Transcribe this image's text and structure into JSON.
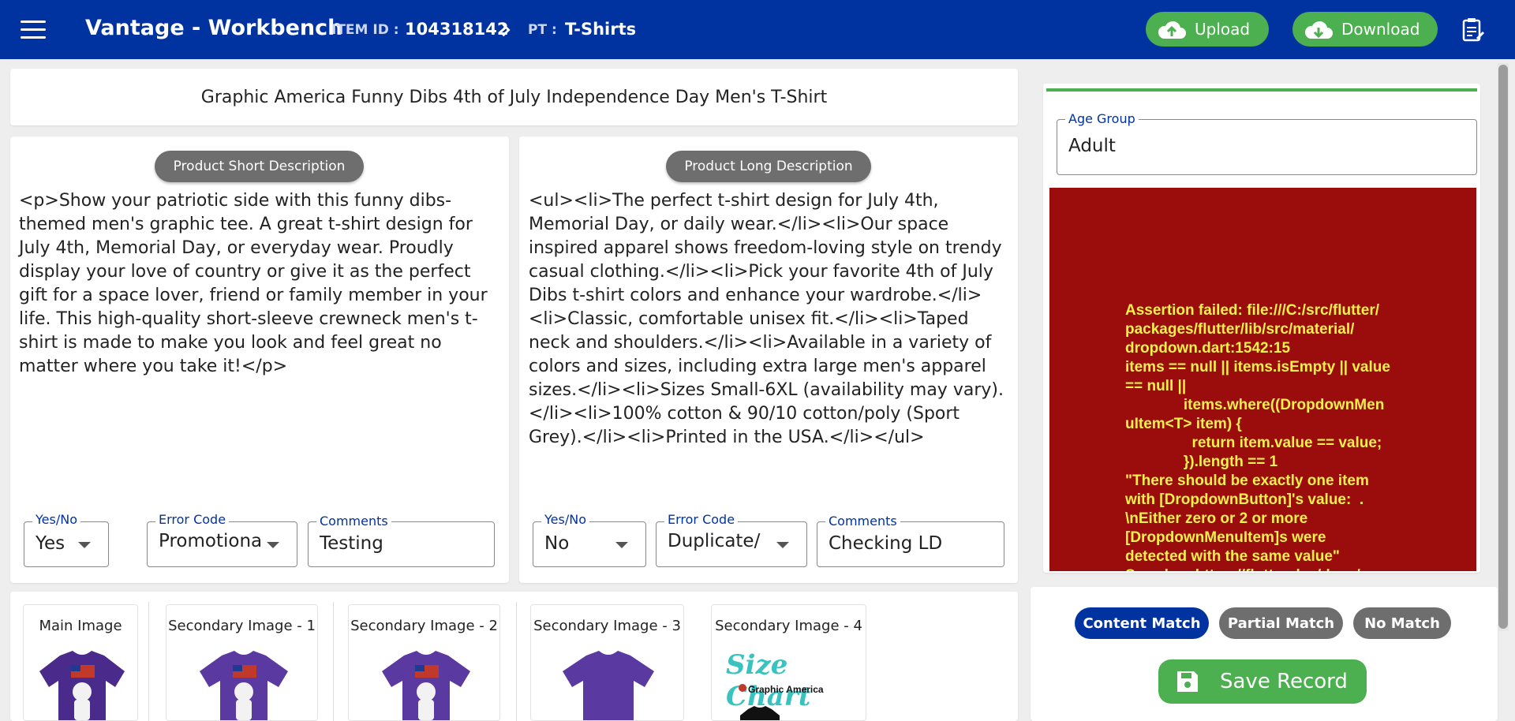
{
  "header": {
    "app_title": "Vantage - Workbench",
    "item_id_label": "ITEM ID :",
    "item_id_value": "104318142",
    "pt_label": "PT :",
    "pt_value": "T-Shirts",
    "upload_label": "Upload",
    "download_label": "Download",
    "icons": [
      "menu-icon",
      "cloud-upload-icon",
      "cloud-download-icon",
      "notes-icon",
      "chevron-right-icon"
    ]
  },
  "product_title": "Graphic America Funny Dibs 4th of July Independence Day Men's T-Shirt",
  "short_description": {
    "chip_label": "Product Short Description",
    "text": "<p>Show your patriotic side with this funny dibs-themed men's graphic tee. A great t-shirt design for July 4th, Memorial Day, or everyday wear. Proudly display your love of country or give it as the perfect gift for a space lover, friend or family member in your life. This high-quality short-sleeve crewneck men's t-shirt is made to make you look and feel great no matter where you take it!</p>",
    "yes_no_label": "Yes/No",
    "yes_no_value": "Yes",
    "error_code_label": "Error Code",
    "error_code_value": "Promotiona",
    "comments_label": "Comments",
    "comments_value": "Testing"
  },
  "long_description": {
    "chip_label": "Product Long Description",
    "text": "<ul><li>The perfect t-shirt design for July 4th, Memorial Day, or daily wear.</li><li>Our space inspired apparel shows freedom-loving style on trendy casual clothing.</li><li>Pick your favorite 4th of July Dibs t-shirt colors and enhance your wardrobe.</li><li>Classic, comfortable unisex fit.</li><li>Taped neck and shoulders.</li><li>Available in a variety of colors and sizes, including extra large men's apparel sizes.</li><li>Sizes Small-6XL (availability may vary).</li><li>100% cotton & 90/10 cotton/poly (Sport Grey).</li><li>Printed in the USA.</li></ul>",
    "yes_no_label": "Yes/No",
    "yes_no_value": "No",
    "error_code_label": "Error Code",
    "error_code_value": "Duplicate/",
    "comments_label": "Comments",
    "comments_value": "Checking LD"
  },
  "images": [
    {
      "caption": "Main Image"
    },
    {
      "caption": "Secondary Image - 1"
    },
    {
      "caption": "Secondary Image - 2"
    },
    {
      "caption": "Secondary Image - 3"
    },
    {
      "caption": "Secondary Image - 4",
      "size_chart_title": "Size Chart",
      "brand": "Graphic America"
    }
  ],
  "age_group": {
    "label": "Age Group",
    "value": "Adult"
  },
  "error_message": "Assertion failed: file:///C:/src/flutter/\npackages/flutter/lib/src/material/\ndropdown.dart:1542:15\nitems == null || items.isEmpty || value\n== null ||\n              items.where((DropdownMen\nuItem<T> item) {\n                return item.value == value;\n              }).length == 1\n\"There should be exactly one item\nwith [DropdownButton]'s value:  .\n\\nEither zero or 2 or more\n[DropdownMenuItem]s were\ndetected with the same value\"\nSee also: https://flutter.dev/docs/",
  "match_buttons": {
    "content_match": "Content Match",
    "partial_match": "Partial Match",
    "no_match": "No Match"
  },
  "save_label": "Save Record",
  "colors": {
    "primary": "#0033a0",
    "green": "#4caf50",
    "grey_chip": "#6e6e6e",
    "error_bg": "#9b0d0d",
    "error_text": "#f5f04a",
    "shirt_purple": "#5a3aa0"
  }
}
